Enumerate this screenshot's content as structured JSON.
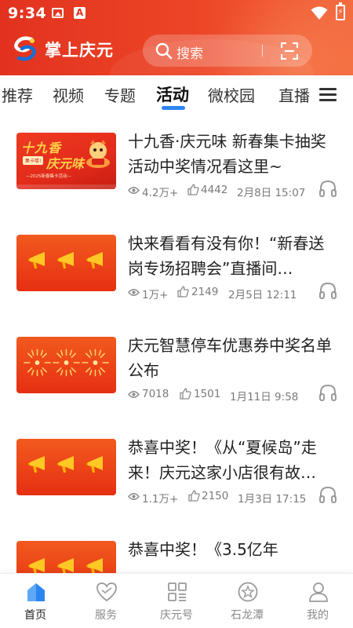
{
  "status_bar": {
    "time": "9:34",
    "battery": "⚡"
  },
  "header": {
    "app_title": "掌上庆元",
    "search_placeholder": "搜索"
  },
  "tabs": [
    {
      "label": "推荐"
    },
    {
      "label": "视频"
    },
    {
      "label": "专题"
    },
    {
      "label": "活动",
      "active": true
    },
    {
      "label": "微校园"
    },
    {
      "label": "直播"
    }
  ],
  "articles": [
    {
      "title": "十九香·庆元味 新春集卡抽奖活动中奖情况看这里~",
      "views": "4.2万+",
      "likes": "4442",
      "date": "2月8日 15:07",
      "thumb": {
        "type": "poster",
        "line1": "十九香",
        "line2": "庆元味",
        "badge": "集卡喽!",
        "caption": "—2025新春集卡活动—"
      }
    },
    {
      "title": "快来看看有没有你！“新春送岗专场招聘会”直播间…",
      "views": "1万+",
      "likes": "2149",
      "date": "2月5日 12:11",
      "thumb": {
        "type": "megaphone"
      }
    },
    {
      "title": "庆元智慧停车优惠券中奖名单公布",
      "views": "7018",
      "likes": "1501",
      "date": "1月11日 9:58",
      "thumb": {
        "type": "firework"
      }
    },
    {
      "title": "恭喜中奖！《从“夏候岛”走来！庆元这家小店很有故…",
      "views": "1.1万+",
      "likes": "2150",
      "date": "1月3日 17:15",
      "thumb": {
        "type": "megaphone"
      }
    },
    {
      "title": "恭喜中奖！《3.5亿年",
      "views": "",
      "likes": "",
      "date": "",
      "thumb": {
        "type": "megaphone"
      }
    }
  ],
  "bottom_nav": [
    {
      "label": "首页",
      "icon": "home-icon",
      "active": true
    },
    {
      "label": "服务",
      "icon": "heart-icon"
    },
    {
      "label": "庆元号",
      "icon": "grid-icon"
    },
    {
      "label": "石龙潭",
      "icon": "star-icon"
    },
    {
      "label": "我的",
      "icon": "user-icon"
    }
  ],
  "colors": {
    "brand_red": "#e2321f",
    "accent_blue": "#2c86ef",
    "meta_gray": "#7a7a7a"
  }
}
